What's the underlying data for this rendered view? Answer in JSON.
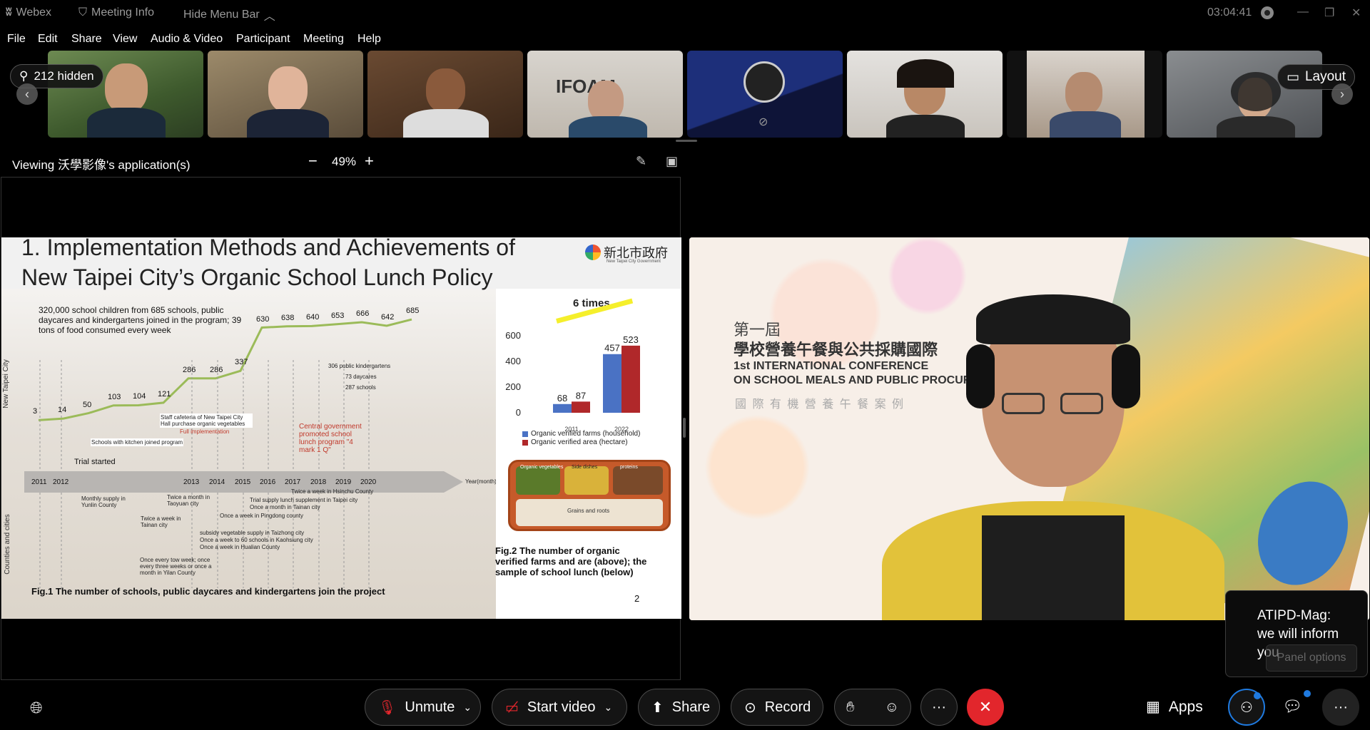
{
  "titlebar": {
    "app_name": "Webex",
    "meeting_info": "Meeting Info",
    "hide_menu": "Hide Menu Bar",
    "clock": "03:04:41"
  },
  "menu": [
    "File",
    "Edit",
    "Share",
    "View",
    "Audio & Video",
    "Participant",
    "Meeting",
    "Help"
  ],
  "filmstrip": {
    "hidden_label": "212 hidden",
    "layout_label": "Layout"
  },
  "viewbar": {
    "viewing_label": "Viewing 沃學影像's application(s)",
    "zoom": "49%",
    "zoom_out": "−",
    "zoom_in": "+"
  },
  "slide": {
    "title_line1": "1. Implementation Methods and Achievements of",
    "title_line2": "New Taipei City’s Organic School Lunch Policy",
    "logo_text": "新北市政府",
    "logo_sub": "New Taipei City Government",
    "intro": "320,000 school children from 685 schools, public daycares and kindergartens joined in the program; 39 tons of food consumed every week",
    "y_axis_label_top": "New Taipei City",
    "y_axis_label_bottom": "Counties and cities",
    "line_values": [
      "3",
      "14",
      "50",
      "103",
      "104",
      "121",
      "286",
      "286",
      "337",
      "630",
      "638",
      "640",
      "653",
      "666",
      "642",
      "685"
    ],
    "years": [
      "2011",
      "2012",
      "2013",
      "2014",
      "2015",
      "2016",
      "2017",
      "2018",
      "2019",
      "2020"
    ],
    "year_axis_label": "Year(month)",
    "note_staff": "Staff cafeteria of New Taipei City Hall purchase organic vegetables",
    "note_full": "Full implementation",
    "note_kitchen": "Schools with kitchen joined program",
    "note_trial": "Trial started",
    "note_central": "Central government promoted school lunch program \"4 mark 1 Q\"",
    "breakdown": [
      "306 public kindergartens",
      "73 daycares",
      "287 schools"
    ],
    "city_notes": [
      "Monthly supply in Yunlin County",
      "Twice a week in Tainan city",
      "Twice a month in Taoyuan city",
      "Once a week in Pingdong county",
      "Twice a week in Hsinchu County",
      "Trial supply lunch supplement in Taipei city",
      "Once a month in Tainan city",
      "subsidy vegetable supply in Taizhong city",
      "Once a week to 60 schools in Kaohsiung city",
      "Once a week in Hualian County",
      "Once every tow week; once every three weeks or once a month in Yilan County"
    ],
    "fig1_caption": "Fig.1 The number of schools, public daycares and kindergartens join the project",
    "six_times": "6 times",
    "fig2_caption": "Fig.2 The number of organic verified farms and are (above); the sample of school lunch (below)",
    "lunch_labels": [
      "Organic vegetables",
      "Side dishes",
      "proteins",
      "Grains and roots"
    ],
    "page_number": "2"
  },
  "chart_data": {
    "type": "bar",
    "categories": [
      "2011",
      "2022"
    ],
    "series": [
      {
        "name": "Organic verified farms (household)",
        "values": [
          68,
          457
        ],
        "color": "#4a72c4"
      },
      {
        "name": "Organic verified area (hectare)",
        "values": [
          87,
          523
        ],
        "color": "#b0282a"
      }
    ],
    "ylim": [
      0,
      600
    ],
    "yticks": [
      "0",
      "200",
      "400",
      "600"
    ],
    "legend": "bottom"
  },
  "video": {
    "banner_line1": "第一屆",
    "banner_line2": "學校營養午餐與公共採購國際",
    "banner_line3": "1st INTERNATIONAL CONFERENCE",
    "banner_line4": "ON SCHOOL MEALS AND PUBLIC PROCUREM",
    "banner_line5": "國 際 有 機 營 養 午 餐 案 例"
  },
  "chat_popup": {
    "sender": "ATIPD-Mag:",
    "message": "we will inform you",
    "panel_options": "Panel options"
  },
  "toolbar": {
    "unmute": "Unmute",
    "start_video": "Start video",
    "share": "Share",
    "record": "Record",
    "apps": "Apps"
  },
  "colors": {
    "end_call": "#e2262c",
    "accent_blue": "#1f7ae0",
    "line_green": "#9bbb59"
  }
}
